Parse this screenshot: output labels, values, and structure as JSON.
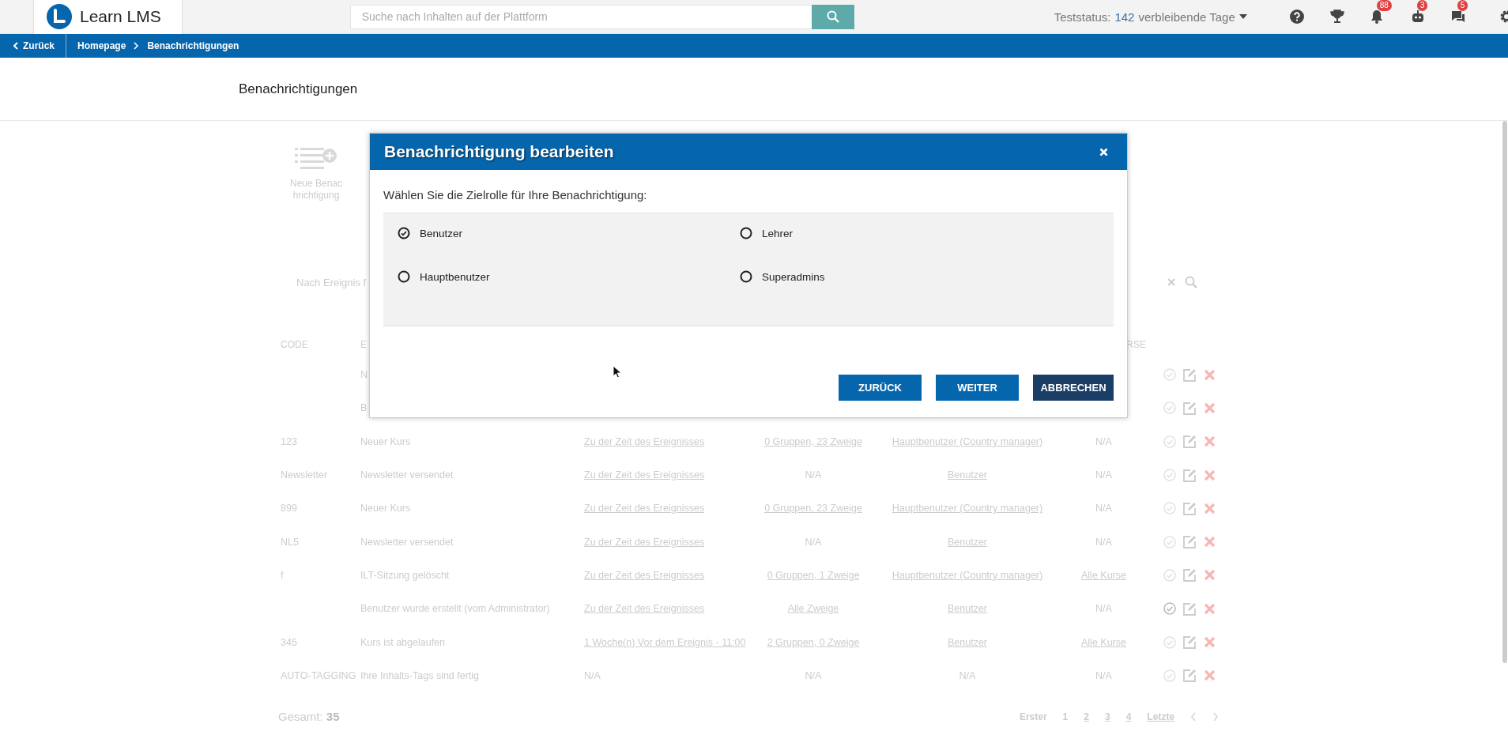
{
  "topbar": {
    "brand": "Learn LMS",
    "search": {
      "placeholder": "Suche nach Inhalten auf der Plattform"
    },
    "trial": {
      "label": "Teststatus:",
      "days": "142",
      "suffix": "verbleibende Tage"
    },
    "icons": [
      {
        "kind": "help"
      },
      {
        "kind": "trophy"
      },
      {
        "kind": "bell",
        "badge": "88"
      },
      {
        "kind": "robot",
        "badge": "3"
      },
      {
        "kind": "chat",
        "badge": "5"
      },
      {
        "kind": "settings"
      }
    ]
  },
  "breadcrumb": {
    "back": "Zurück",
    "items": [
      "Homepage",
      "Benachrichtigungen"
    ]
  },
  "page_title": "Benachrichtigungen",
  "new_button": {
    "label": "Neue Benachrichtigung"
  },
  "filter": {
    "label": "Nach Ereignis f"
  },
  "table": {
    "header": {
      "code": "CODE",
      "event": "E",
      "courses": "RSE"
    },
    "rows": [
      {
        "event": "N",
        "active": false
      },
      {
        "event": "B",
        "active": false
      },
      {
        "code": "123",
        "event": "Neuer Kurs",
        "timing": {
          "text": "Zu der Zeit des Ereignisses",
          "link": true
        },
        "recipients": {
          "text": "0 Gruppen, 23 Zweige",
          "link": true
        },
        "role": {
          "text": "Hauptbenutzer (Country manager)",
          "link": true
        },
        "courses": {
          "text": "N/A",
          "link": false
        },
        "active": false
      },
      {
        "code": "Newsletter",
        "event": "Newsletter versendet",
        "timing": {
          "text": "Zu der Zeit des Ereignisses",
          "link": true
        },
        "recipients": {
          "text": "N/A",
          "link": false
        },
        "role": {
          "text": "Benutzer",
          "link": true
        },
        "courses": {
          "text": "N/A",
          "link": false
        },
        "active": false
      },
      {
        "code": "899",
        "event": "Neuer Kurs",
        "timing": {
          "text": "Zu der Zeit des Ereignisses",
          "link": true
        },
        "recipients": {
          "text": "0 Gruppen, 23 Zweige",
          "link": true
        },
        "role": {
          "text": "Hauptbenutzer (Country manager)",
          "link": true
        },
        "courses": {
          "text": "N/A",
          "link": false
        },
        "active": false
      },
      {
        "code": "NL5",
        "event": "Newsletter versendet",
        "timing": {
          "text": "Zu der Zeit des Ereignisses",
          "link": true
        },
        "recipients": {
          "text": "N/A",
          "link": false
        },
        "role": {
          "text": "Benutzer",
          "link": true
        },
        "courses": {
          "text": "N/A",
          "link": false
        },
        "active": false
      },
      {
        "code": "f",
        "event": "ILT-Sitzung gelöscht",
        "timing": {
          "text": "Zu der Zeit des Ereignisses",
          "link": true
        },
        "recipients": {
          "text": "0 Gruppen, 1 Zweige",
          "link": true
        },
        "role": {
          "text": "Hauptbenutzer (Country manager)",
          "link": true
        },
        "courses": {
          "text": "Alle Kurse",
          "link": true
        },
        "active": false
      },
      {
        "event": "Benutzer wurde erstellt (vom Administrator)",
        "timing": {
          "text": "Zu der Zeit des Ereignisses",
          "link": true
        },
        "recipients": {
          "text": "Alle Zweige",
          "link": true
        },
        "role": {
          "text": "Benutzer",
          "link": true
        },
        "courses": {
          "text": "N/A",
          "link": false
        },
        "active": true
      },
      {
        "code": "345",
        "event": "Kurs ist abgelaufen",
        "timing": {
          "text": "1 Woche(n) Vor dem Ereignis - 11:00",
          "link": true
        },
        "recipients": {
          "text": "2 Gruppen, 0 Zweige",
          "link": true
        },
        "role": {
          "text": "Benutzer",
          "link": true
        },
        "courses": {
          "text": "Alle Kurse",
          "link": true
        },
        "active": false
      },
      {
        "code": "AUTO-TAGGING",
        "event": "Ihre Inhalts-Tags sind fertig",
        "timing": {
          "text": "N/A",
          "link": false
        },
        "recipients": {
          "text": "N/A",
          "link": false
        },
        "role": {
          "text": "N/A",
          "link": false
        },
        "courses": {
          "text": "N/A",
          "link": false
        },
        "active": false
      }
    ]
  },
  "footer": {
    "total_label": "Gesamt:",
    "total": "35",
    "first": "Erster",
    "pages": [
      {
        "label": "1",
        "selected": true
      },
      {
        "label": "2",
        "selected": false
      },
      {
        "label": "3",
        "selected": false
      },
      {
        "label": "4",
        "selected": false
      }
    ],
    "last": "Letzte"
  },
  "dialog": {
    "title": "Benachrichtigung bearbeiten",
    "prompt": "Wählen Sie die Zielrolle für Ihre Benachrichtigung:",
    "options": [
      {
        "label": "Benutzer",
        "selected": true
      },
      {
        "label": "Lehrer",
        "selected": false
      },
      {
        "label": "Hauptbenutzer",
        "selected": false
      },
      {
        "label": "Superadmins",
        "selected": false
      }
    ],
    "buttons": [
      {
        "label": "ZURÜCK",
        "kind": "primary"
      },
      {
        "label": "WEITER",
        "kind": "primary"
      },
      {
        "label": "ABBRECHEN",
        "kind": "dark"
      }
    ]
  }
}
